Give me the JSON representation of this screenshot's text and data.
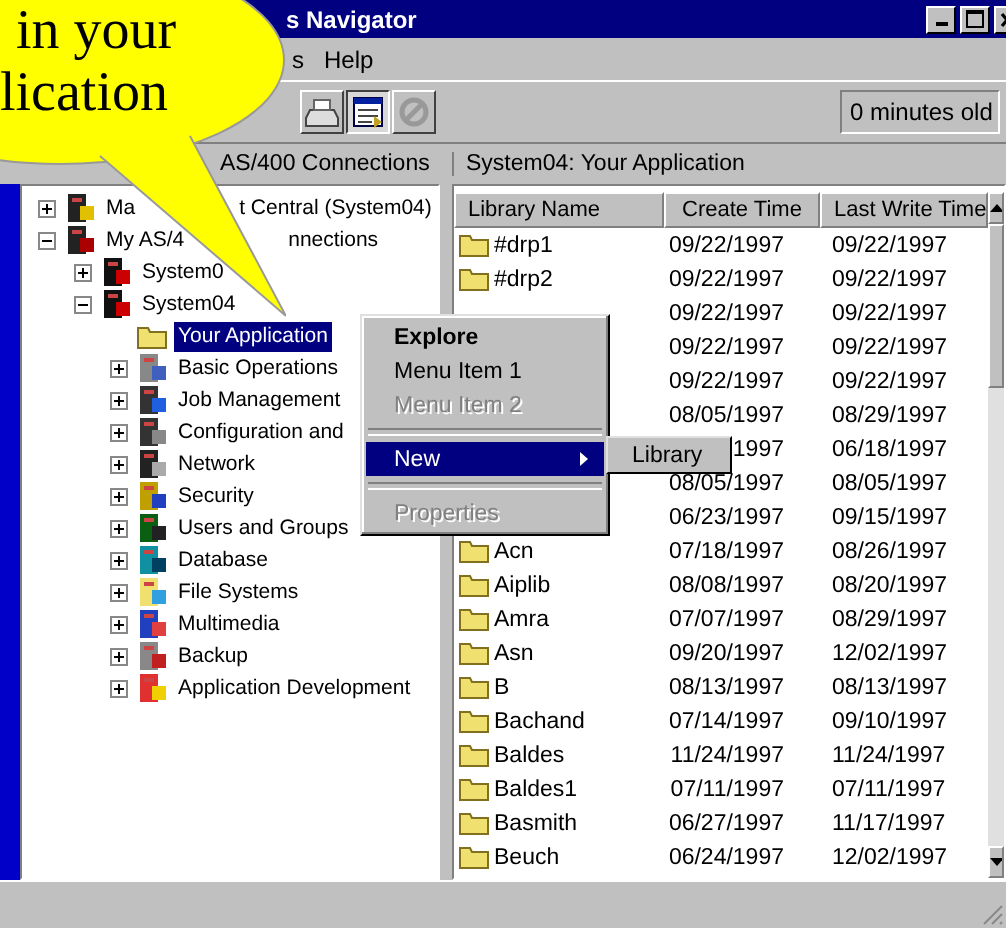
{
  "window": {
    "title": "s Navigator"
  },
  "bubble": {
    "lines": [
      "in your",
      "lication"
    ]
  },
  "menu_bar": [
    "s",
    "Help"
  ],
  "toolbar": {
    "age": "0 minutes old"
  },
  "tree_header": "AS/400 Connections",
  "list_header": "System04:  Your Application",
  "tree": [
    {
      "kind": "central",
      "label": [
        "Ma",
        "t Central (System04)"
      ],
      "expanded": false,
      "selected": false
    },
    {
      "kind": "connections",
      "label": [
        "My AS/4",
        "nnections"
      ],
      "expanded": true,
      "selected": false,
      "children": [
        {
          "kind": "system",
          "label": [
            "System0"
          ],
          "expanded": false,
          "selected": false
        },
        {
          "kind": "system",
          "label": [
            "System04"
          ],
          "expanded": true,
          "selected": false,
          "children": [
            {
              "kind": "folder",
              "label": [
                "Your Application"
              ],
              "selected": true
            },
            {
              "kind": "operations",
              "label": [
                "Basic Operations"
              ],
              "expanded": false,
              "selected": false
            },
            {
              "kind": "jobs",
              "label": [
                "Job Management"
              ],
              "expanded": false,
              "selected": false
            },
            {
              "kind": "config",
              "label": [
                "Configuration and"
              ],
              "expanded": false,
              "selected": false
            },
            {
              "kind": "network",
              "label": [
                "Network"
              ],
              "expanded": false,
              "selected": false
            },
            {
              "kind": "security",
              "label": [
                "Security"
              ],
              "expanded": false,
              "selected": false
            },
            {
              "kind": "users",
              "label": [
                "Users and Groups"
              ],
              "expanded": false,
              "selected": false
            },
            {
              "kind": "database",
              "label": [
                "Database"
              ],
              "expanded": false,
              "selected": false
            },
            {
              "kind": "files",
              "label": [
                "File Systems"
              ],
              "expanded": false,
              "selected": false
            },
            {
              "kind": "multimedia",
              "label": [
                "Multimedia"
              ],
              "expanded": false,
              "selected": false
            },
            {
              "kind": "backup",
              "label": [
                "Backup"
              ],
              "expanded": false,
              "selected": false
            },
            {
              "kind": "development",
              "label": [
                "Application Development"
              ],
              "expanded": false,
              "selected": false
            }
          ]
        }
      ]
    }
  ],
  "context_menu": [
    {
      "kind": "item",
      "label": "Explore",
      "default": true,
      "disabled": false,
      "selected": false
    },
    {
      "kind": "item",
      "label": "Menu Item 1",
      "default": false,
      "disabled": false,
      "selected": false
    },
    {
      "kind": "item",
      "label": "Menu Item 2",
      "default": false,
      "disabled": true,
      "selected": false
    },
    {
      "kind": "separator"
    },
    {
      "kind": "submenu",
      "label": "New",
      "default": false,
      "disabled": false,
      "selected": true
    },
    {
      "kind": "separator"
    },
    {
      "kind": "item",
      "label": "Properties",
      "default": false,
      "disabled": true,
      "selected": false
    }
  ],
  "submenu": [
    {
      "label": "Library",
      "selected": false
    }
  ],
  "list": {
    "columns": [
      "Library Name",
      "Create Time",
      "Last Write Time"
    ],
    "rows": [
      {
        "name": "#drp1",
        "created": "09/22/1997",
        "modified": "09/22/1997"
      },
      {
        "name": "#drp2",
        "created": "09/22/1997",
        "modified": "09/22/1997"
      },
      {
        "created": "09/22/1997",
        "modified": "09/22/1997"
      },
      {
        "created": "09/22/1997",
        "modified": "09/22/1997"
      },
      {
        "created": "09/22/1997",
        "modified": "09/22/1997"
      },
      {
        "created": "08/05/1997",
        "modified": "08/29/1997"
      },
      {
        "created": "1997",
        "modified": "06/18/1997"
      },
      {
        "created": "08/05/1997",
        "modified": "08/05/1997"
      },
      {
        "created": "06/23/1997",
        "modified": "09/15/1997"
      },
      {
        "name": "Acn",
        "created": "07/18/1997",
        "modified": "08/26/1997"
      },
      {
        "name": "Aiplib",
        "created": "08/08/1997",
        "modified": "08/20/1997"
      },
      {
        "name": "Amra",
        "created": "07/07/1997",
        "modified": "08/29/1997"
      },
      {
        "name": "Asn",
        "created": "09/20/1997",
        "modified": "12/02/1997"
      },
      {
        "name": "B",
        "created": "08/13/1997",
        "modified": "08/13/1997"
      },
      {
        "name": "Bachand",
        "created": "07/14/1997",
        "modified": "09/10/1997"
      },
      {
        "name": "Baldes",
        "created": "11/24/1997",
        "modified": "11/24/1997"
      },
      {
        "name": "Baldes1",
        "created": "07/11/1997",
        "modified": "07/11/1997"
      },
      {
        "name": "Basmith",
        "created": "06/27/1997",
        "modified": "11/17/1997"
      },
      {
        "name": "Beuch",
        "created": "06/24/1997",
        "modified": "12/02/1997"
      }
    ]
  }
}
